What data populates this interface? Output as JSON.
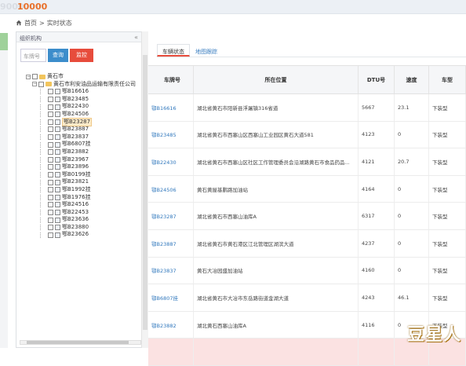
{
  "header": {
    "brand_faded": "9000",
    "brand": "10000"
  },
  "breadcrumb": {
    "home": "首页",
    "separator": ">",
    "current": "实时状态"
  },
  "left_panel": {
    "title": "组织机构",
    "collapse_glyph": "«",
    "search_placeholder": "车牌号",
    "query_button": "查询",
    "monitor_button": "监控",
    "tree": {
      "root": "黄石市",
      "company": "黄石市利安油品运输有限责任公司",
      "vehicles": [
        "鄂B16616",
        "鄂B23485",
        "鄂B22430",
        "鄂B24506",
        "鄂B23287",
        "鄂B23887",
        "鄂B23837",
        "鄂B6807挂",
        "鄂B23882",
        "鄂B23967",
        "鄂B23896",
        "鄂B0199挂",
        "鄂B23821",
        "鄂B1992挂",
        "鄂B1976挂",
        "鄂B24516",
        "鄂B22453",
        "鄂B23636",
        "鄂B23880",
        "鄂B23626"
      ],
      "highlighted_index": 4
    }
  },
  "tabs": [
    {
      "label": "车辆状态",
      "active": true
    },
    {
      "label": "地图跟踪",
      "active": false
    }
  ],
  "table": {
    "columns": [
      "车牌号",
      "所在位置",
      "DTU号",
      "速度",
      "车型"
    ],
    "rows": [
      [
        "鄂B16616",
        "湖北省黄石市阳新县浮屠镇316省道",
        "5667",
        "23.1",
        "下装型"
      ],
      [
        "鄂B23485",
        "湖北省黄石市西塞山区西塞山工业园区黄石大道581",
        "4123",
        "0",
        "下装型"
      ],
      [
        "鄂B22430",
        "湖北省黄石市西塞山区社区工作管理委员会沿湖路黄石市食品药品...",
        "4121",
        "20.7",
        "下装型"
      ],
      [
        "鄂B24506",
        "黄石黄屋基鹏路加油站",
        "4164",
        "0",
        "下装型"
      ],
      [
        "鄂B23287",
        "湖北省黄石市西塞山油库A",
        "6317",
        "0",
        "下装型"
      ],
      [
        "鄂B23887",
        "湖北省黄石市黄石港区江北管理区湖滨大道",
        "4237",
        "0",
        "下装型"
      ],
      [
        "鄂B23837",
        "黄石大冶园盛加油站",
        "4160",
        "0",
        "下装型"
      ],
      [
        "鄂B6807挂",
        "湖北省黄石市大冶市东岳路街道金湖大道",
        "4243",
        "46.1",
        "下装型"
      ],
      [
        "鄂B23882",
        "湖北黄石西塞山油库A",
        "4116",
        "0",
        "下装型"
      ]
    ]
  },
  "watermark": "豆星人"
}
